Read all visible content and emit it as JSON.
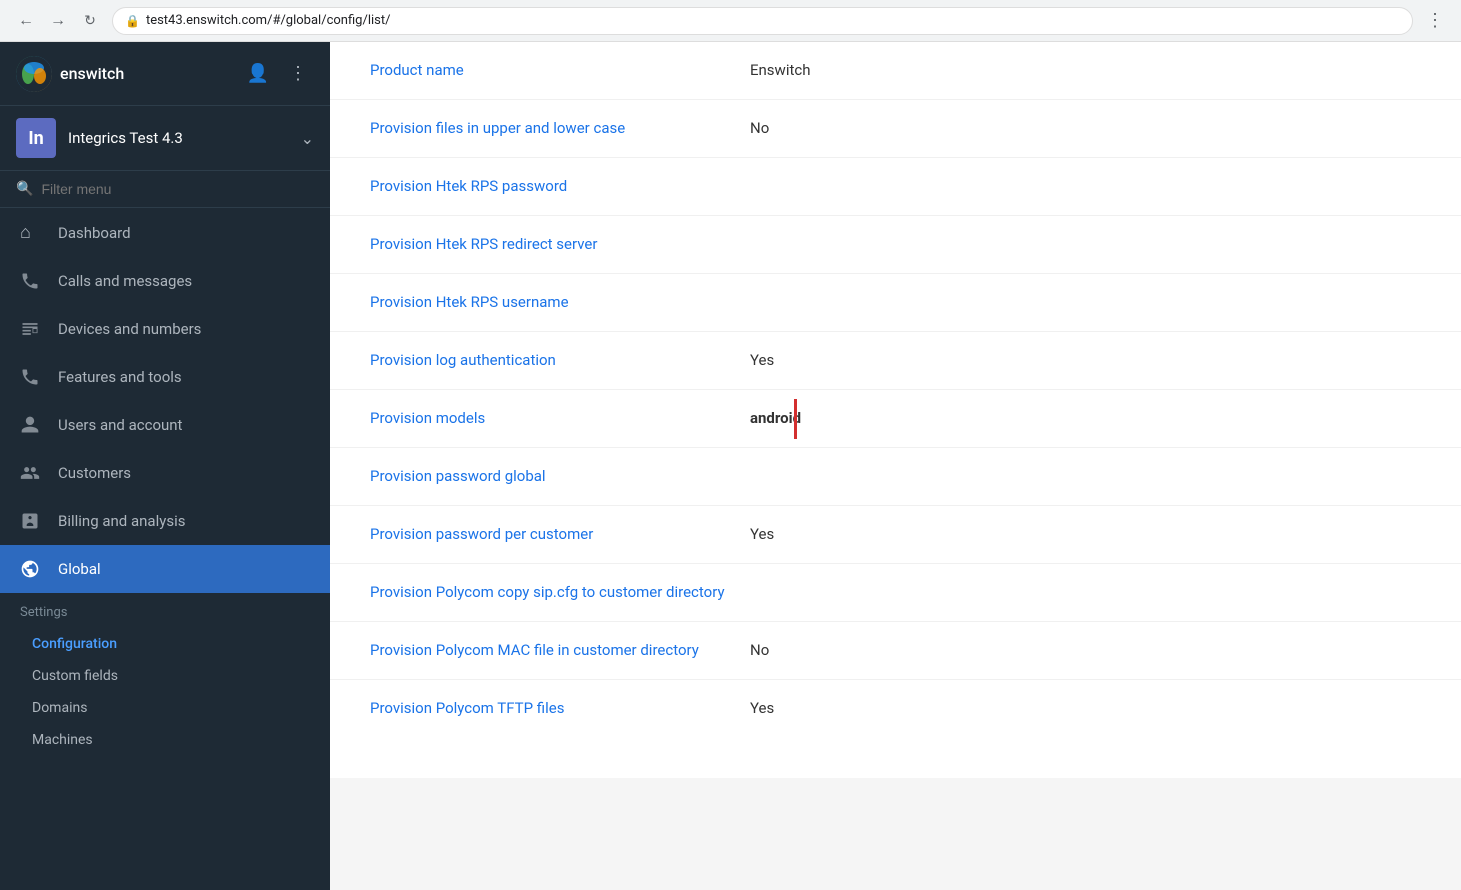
{
  "browser": {
    "url": "test43.enswitch.com/#/global/config/list/",
    "lock_symbol": "🔒"
  },
  "sidebar": {
    "logo_text": "enswitch",
    "account": {
      "initials": "In",
      "name": "Integrics Test 4.3"
    },
    "filter_placeholder": "Filter menu",
    "nav_items": [
      {
        "id": "dashboard",
        "label": "Dashboard",
        "icon": "⌂"
      },
      {
        "id": "calls",
        "label": "Calls and messages",
        "icon": "📞"
      },
      {
        "id": "devices",
        "label": "Devices and numbers",
        "icon": "⊞"
      },
      {
        "id": "features",
        "label": "Features and tools",
        "icon": "☎"
      },
      {
        "id": "users",
        "label": "Users and account",
        "icon": "👤"
      },
      {
        "id": "customers",
        "label": "Customers",
        "icon": "👥"
      },
      {
        "id": "billing",
        "label": "Billing and analysis",
        "icon": "⊟"
      },
      {
        "id": "global",
        "label": "Global",
        "icon": "🌐",
        "active": true
      }
    ],
    "settings_label": "Settings",
    "sub_items": [
      {
        "id": "configuration",
        "label": "Configuration",
        "active": true
      },
      {
        "id": "custom-fields",
        "label": "Custom fields"
      },
      {
        "id": "domains",
        "label": "Domains"
      },
      {
        "id": "machines",
        "label": "Machines"
      }
    ]
  },
  "config_rows": [
    {
      "name": "Product name",
      "value": "Enswitch",
      "value_bold": false,
      "has_indicator": false
    },
    {
      "name": "Provision files in upper and lower case",
      "value": "No",
      "value_bold": false,
      "has_indicator": false
    },
    {
      "name": "Provision Htek RPS password",
      "value": "",
      "value_bold": false,
      "has_indicator": false
    },
    {
      "name": "Provision Htek RPS redirect server",
      "value": "",
      "value_bold": false,
      "has_indicator": false
    },
    {
      "name": "Provision Htek RPS username",
      "value": "",
      "value_bold": false,
      "has_indicator": false
    },
    {
      "name": "Provision log authentication",
      "value": "Yes",
      "value_bold": false,
      "has_indicator": false
    },
    {
      "name": "Provision models",
      "value": "android",
      "value_bold": true,
      "has_indicator": true
    },
    {
      "name": "Provision password global",
      "value": "",
      "value_bold": false,
      "has_indicator": false
    },
    {
      "name": "Provision password per customer",
      "value": "Yes",
      "value_bold": false,
      "has_indicator": false
    },
    {
      "name": "Provision Polycom copy sip.cfg to customer directory",
      "value": "",
      "value_bold": false,
      "has_indicator": false
    },
    {
      "name": "Provision Polycom MAC file in customer directory",
      "value": "No",
      "value_bold": false,
      "has_indicator": false
    },
    {
      "name": "Provision Polycom TFTP files",
      "value": "Yes",
      "value_bold": false,
      "has_indicator": false
    }
  ]
}
